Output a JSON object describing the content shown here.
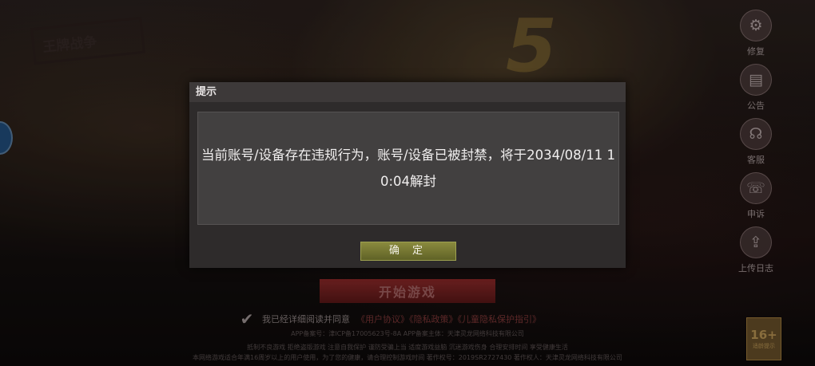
{
  "background": {
    "logo_text": "王牌战争",
    "start_button": "开始游戏",
    "agreement_text": "我已经详细阅读并同意",
    "agreement_links": "《用户协议》《隐私政策》《儿童隐私保护指引》",
    "legal_line_1": "APP备案号：津ICP备17005623号-8A  APP备案主体：天津灵龙网络科技有限公司",
    "legal_line_2": "抵制不良游戏 拒绝盗版游戏 注意自我保护 谨防受骗上当 适度游戏益脑 沉迷游戏伤身 合理安排时间 享受健康生活",
    "legal_line_3": "本网络游戏适合年满16周岁以上的用户使用，为了您的健康，请合理控制游戏时间  著作权号：2019SR2727430  著作权人：天津灵龙网络科技有限公司",
    "age_rating": "16+",
    "age_tip": "适龄提示"
  },
  "sidebar": {
    "items": [
      {
        "label": "修复",
        "icon": "gear-icon"
      },
      {
        "label": "公告",
        "icon": "notice-icon"
      },
      {
        "label": "客服",
        "icon": "headset-icon"
      },
      {
        "label": "申诉",
        "icon": "phone-icon"
      },
      {
        "label": "上传日志",
        "icon": "upload-icon"
      }
    ]
  },
  "dialog": {
    "title": "提示",
    "message": "当前账号/设备存在违规行为，账号/设备已被封禁，将于2034/08/11 10:04解封",
    "confirm_label": "确 定"
  }
}
